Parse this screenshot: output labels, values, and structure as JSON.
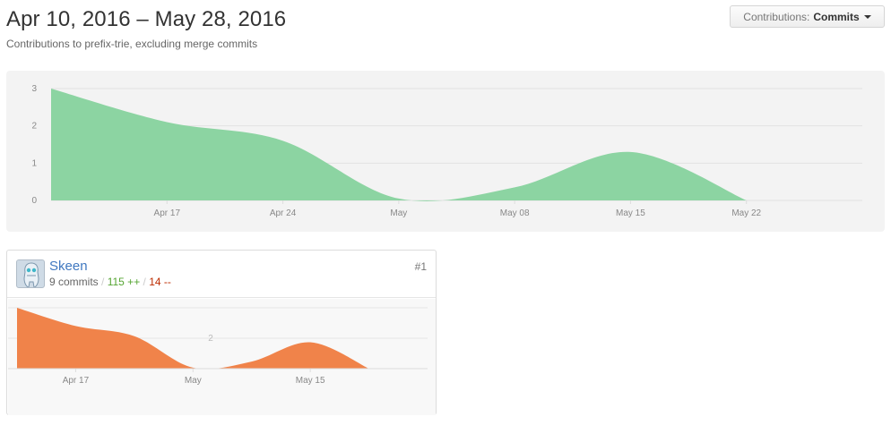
{
  "header": {
    "title": "Apr 10, 2016 – May 28, 2016",
    "subtitle": "Contributions to prefix-trie, excluding merge commits"
  },
  "contributions_button": {
    "label": "Contributions:",
    "value": "Commits"
  },
  "colors": {
    "main_area": "#8cd4a2",
    "card_area": "#f0834a",
    "link": "#4078c0",
    "additions": "#55a532",
    "deletions": "#bd2c00"
  },
  "chart_data": [
    {
      "type": "area",
      "x_ticks": [
        "Apr 17",
        "Apr 24",
        "May",
        "May 08",
        "May 15",
        "May 22"
      ],
      "y_ticks": [
        "0",
        "1",
        "2",
        "3"
      ],
      "ylim": [
        0,
        3
      ],
      "x": [
        "2016-04-10",
        "2016-04-17",
        "2016-04-24",
        "2016-05-01",
        "2016-05-08",
        "2016-05-15",
        "2016-05-22"
      ],
      "values": [
        3,
        2.1,
        1.6,
        0.05,
        0.35,
        1.3,
        0
      ],
      "grid": true
    },
    {
      "type": "area",
      "x_ticks": [
        "Apr 17",
        "May",
        "May 15"
      ],
      "y_ticks": [
        "2"
      ],
      "x": [
        "2016-04-10",
        "2016-04-17",
        "2016-04-24",
        "2016-05-01",
        "2016-05-08",
        "2016-05-15",
        "2016-05-22"
      ],
      "values": [
        3,
        2.1,
        1.6,
        0.05,
        0.35,
        1.3,
        0
      ],
      "grid": true
    }
  ],
  "contributor": {
    "name": "Skeen",
    "commits": "9 commits",
    "separator": "/",
    "additions": "115 ++",
    "deletions": "14 --",
    "rank": "#1",
    "avatar_icon": "robot-avatar-icon"
  }
}
